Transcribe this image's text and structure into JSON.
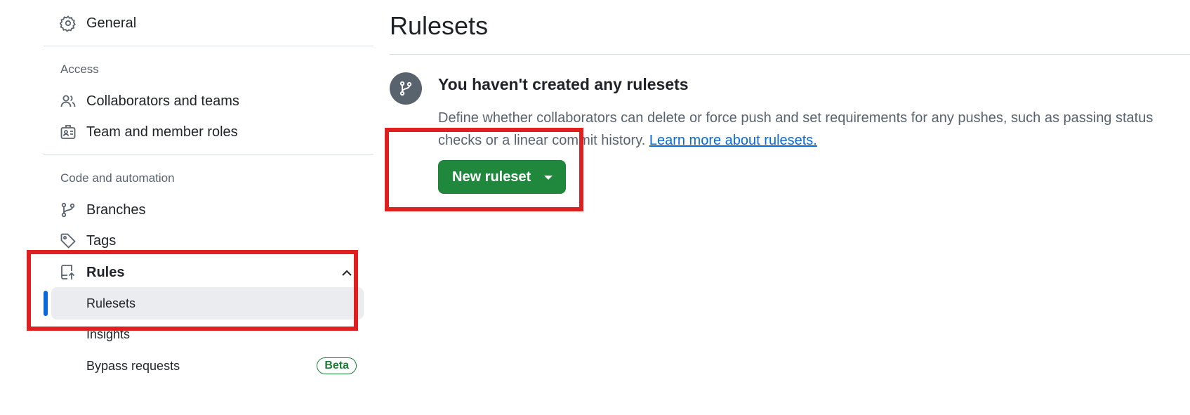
{
  "sidebar": {
    "general": {
      "label": "General",
      "icon": "gear-icon"
    },
    "access": {
      "heading": "Access",
      "items": [
        {
          "label": "Collaborators and teams",
          "icon": "people-icon"
        },
        {
          "label": "Team and member roles",
          "icon": "id-badge-icon"
        }
      ]
    },
    "code_automation": {
      "heading": "Code and automation",
      "items": [
        {
          "label": "Branches",
          "icon": "git-branch-icon"
        },
        {
          "label": "Tags",
          "icon": "tag-icon"
        }
      ]
    },
    "rules": {
      "label": "Rules",
      "icon": "repo-push-icon",
      "expanded": true,
      "subitems": [
        {
          "label": "Rulesets",
          "active": true
        },
        {
          "label": "Insights"
        },
        {
          "label": "Bypass requests",
          "badge": "Beta"
        }
      ]
    }
  },
  "main": {
    "title": "Rulesets",
    "blankslate": {
      "icon": "git-branch-icon",
      "heading": "You haven't created any rulesets",
      "description": "Define whether collaborators can delete or force push and set requirements for any pushes, such as passing status checks or a linear commit history.",
      "link_text": "Learn more about rulesets.",
      "button_label": "New ruleset"
    }
  },
  "colors": {
    "primary_button": "#1f883d",
    "link": "#0969da",
    "active_indicator": "#0969da",
    "highlight_annotation": "#e02020",
    "beta_badge": "#1a7f37"
  }
}
